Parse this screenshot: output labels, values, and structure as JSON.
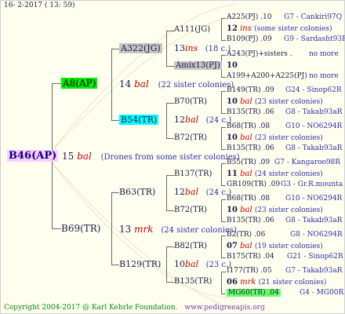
{
  "header": {
    "date": "16-  2-2017 ( 13: 59)"
  },
  "footer": {
    "copyright": "Copyright 2004-2017 @ Karl Kehrle Foundation.",
    "url": "www.pedigreeapis.org"
  },
  "root": {
    "label": "B46(AP)",
    "gen_num": "15",
    "gen_breed": "bal",
    "gen_note": "(Drones from some sister colonies)"
  },
  "a8": {
    "label": "A8(AP)",
    "gen_num": "14",
    "gen_breed": "bal",
    "gen_note": "(22 sister colonies)"
  },
  "b69": {
    "label": "B69(TR)",
    "gen_num": "13",
    "gen_breed": "mrk",
    "gen_note": "(24 sister colonies)"
  },
  "a322": {
    "label": "A322(JG)",
    "gen_num": "13",
    "gen_breed": "ins",
    "gen_note": "(18 c.)"
  },
  "b54": {
    "label": "B54(TR)",
    "gen_num": "12",
    "gen_breed": "bal",
    "gen_note": "(24 c.)"
  },
  "b63": {
    "label": "B63(TR)",
    "gen_num": "12",
    "gen_breed": "bal",
    "gen_note": "(24 c.)"
  },
  "b129": {
    "label": "B129(TR)",
    "gen_num": "10",
    "gen_breed": "bal",
    "gen_note": "(23 c.)"
  },
  "g4": {
    "a111": "A111(JG)",
    "amix13": "Amix13(PJ)",
    "b70": "B70(TR)",
    "b72a": "B72(TR)",
    "b137": "B137(TR)",
    "b72b": "B72(TR)",
    "b82": "B82(TR)",
    "b135": "B135(TR)"
  },
  "g5": [
    {
      "label": "A225(PJ)",
      "year": ".10",
      "right": "G7 - Cankiri97Q"
    },
    {
      "num": "12",
      "breed": "ins",
      "note": "(some sister colonies)"
    },
    {
      "label": "B109(PJ)",
      "year": ".09",
      "right": "G9 - Sardasht93R"
    },
    {
      "label": "A243(PJ)+sisters .",
      "right": "no more"
    },
    {
      "num": "10"
    },
    {
      "label": "A199+A200+A225(PJ)",
      "right": "no more"
    },
    {
      "label": "B149(TR)",
      "year": ".09",
      "right": "G24 - Sinop62R"
    },
    {
      "num": "10",
      "breed": "bal",
      "note": "(23 sister colonies)"
    },
    {
      "label": "B135(TR)",
      "year": ".06",
      "right": "G8 - Takab93aR"
    },
    {
      "label": "B68(TR)",
      "year": ".08",
      "right": "G10 - NO6294R"
    },
    {
      "num": "10",
      "breed": "bal",
      "note": "(23 sister colonies)"
    },
    {
      "label": "B135(TR)",
      "year": ".06",
      "right": "G8 - Takab93aR"
    },
    {
      "label": "B55(TR)",
      "year": ".09",
      "right": "G7 - Kangaroo98R"
    },
    {
      "num": "11",
      "breed": "bal",
      "note": "(24 sister colonies)"
    },
    {
      "label": "GR109(TR)",
      "year": ".09",
      "right": "G3 - Gr.R.mounta"
    },
    {
      "label": "B68(TR)",
      "year": ".08",
      "right": "G10 - NO6294R"
    },
    {
      "num": "10",
      "breed": "bal",
      "note": "(23 sister colonies)"
    },
    {
      "label": "B135(TR)",
      "year": ".06",
      "right": "G8 - Takab93aR"
    },
    {
      "label": "B2(TR)",
      "year": ".06",
      "right": "G8 - NO6294R"
    },
    {
      "num": "07",
      "breed": "bal",
      "note": "(19 sister colonies)"
    },
    {
      "label": "B175(TR)",
      "year": ".04",
      "right": "G21 - Sinop62R"
    },
    {
      "label": "I177(TR)",
      "year": ".05",
      "right": "G7 - Takab93aR"
    },
    {
      "num": "06",
      "breed": "mrk",
      "note": "(21 sister colonies)"
    },
    {
      "label": "MG60(TR)",
      "year": ".04",
      "right": "G4 - MG00R"
    }
  ]
}
